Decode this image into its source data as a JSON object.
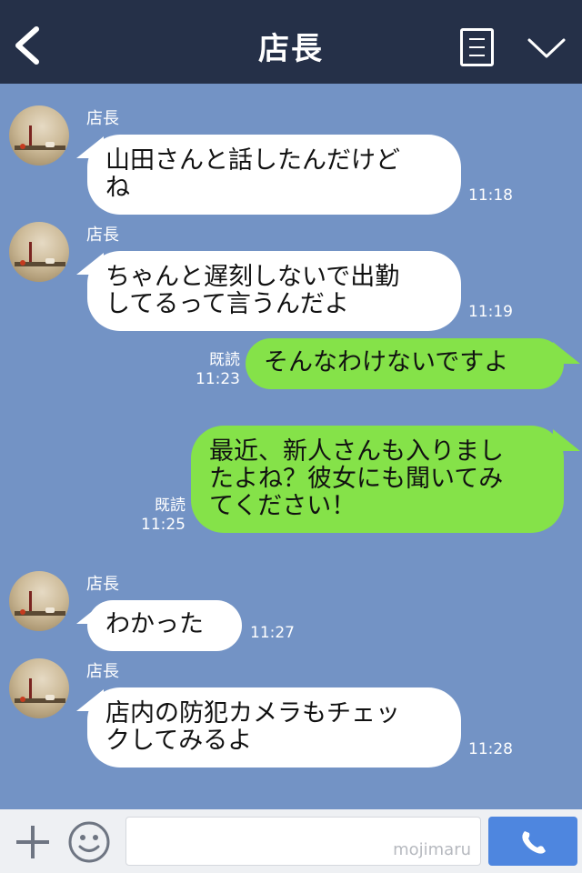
{
  "header": {
    "title": "店長",
    "back_icon": "chevron-left-icon",
    "memo_icon": "notes-icon",
    "menu_icon": "chevron-down-icon",
    "background": "#253048"
  },
  "chat": {
    "background": "#7393c5",
    "messages": [
      {
        "side": "in",
        "sender": "店長",
        "lines": [
          "山田さんと話したんだけど",
          "ね"
        ],
        "time": "11:18"
      },
      {
        "side": "in",
        "sender": "店長",
        "lines": [
          "ちゃんと遅刻しないで出勤",
          "してるって言うんだよ"
        ],
        "time": "11:19"
      },
      {
        "side": "out",
        "read": "既読",
        "lines": [
          "そんなわけないですよ"
        ],
        "time": "11:23"
      },
      {
        "side": "out",
        "read": "既読",
        "lines": [
          "最近、新人さんも入りまし",
          "たよね？彼女にも聞いてみ",
          "てください！"
        ],
        "time": "11:25"
      },
      {
        "side": "in",
        "sender": "店長",
        "lines": [
          "わかった"
        ],
        "time": "11:27"
      },
      {
        "side": "in",
        "sender": "店長",
        "lines": [
          "店内の防犯カメラもチェッ",
          "クしてみるよ"
        ],
        "time": "11:28"
      }
    ]
  },
  "footer": {
    "plus_icon": "plus-icon",
    "emoji_icon": "smiley-icon",
    "input_value": "",
    "watermark": "mojimaru",
    "call_icon": "phone-icon",
    "call_color": "#4e86df"
  },
  "colors": {
    "incoming_bubble": "#ffffff",
    "outgoing_bubble": "#85e249"
  }
}
